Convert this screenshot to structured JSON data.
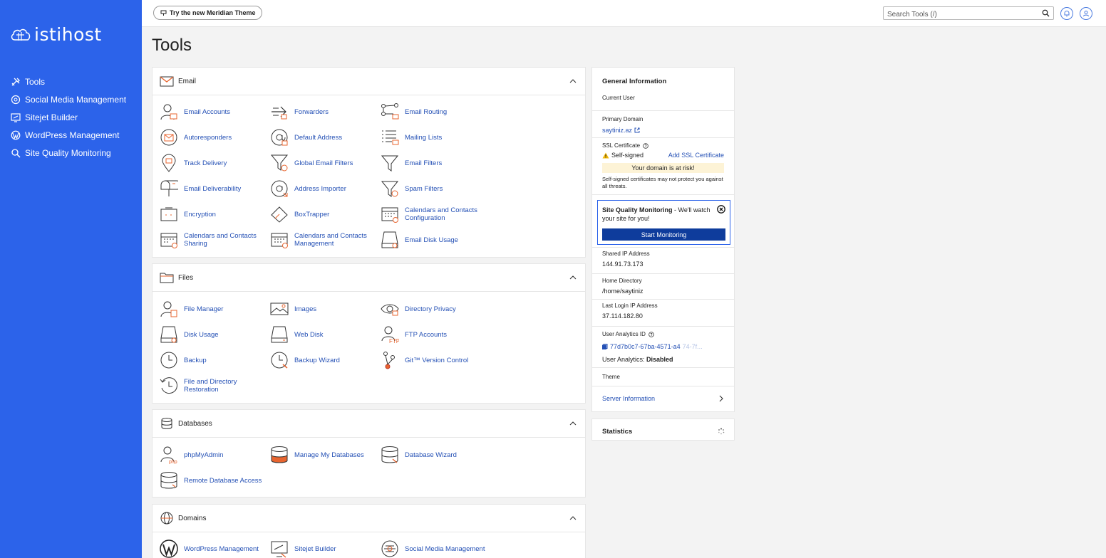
{
  "sidebar": {
    "logo_text": "istihost",
    "items": [
      {
        "label": "Tools",
        "icon": "tools-icon"
      },
      {
        "label": "Social Media Management",
        "icon": "social-media-icon"
      },
      {
        "label": "Sitejet Builder",
        "icon": "sitejet-icon"
      },
      {
        "label": "WordPress Management",
        "icon": "wordpress-icon"
      },
      {
        "label": "Site Quality Monitoring",
        "icon": "magnifier-icon"
      }
    ]
  },
  "topbar": {
    "theme_button": "Try the new Meridian Theme",
    "search_placeholder": "Search Tools (/)"
  },
  "page_title": "Tools",
  "sections": {
    "email": {
      "title": "Email",
      "tools": [
        "Email Accounts",
        "Forwarders",
        "Email Routing",
        "Autoresponders",
        "Default Address",
        "Mailing Lists",
        "Track Delivery",
        "Global Email Filters",
        "Email Filters",
        "Email Deliverability",
        "Address Importer",
        "Spam Filters",
        "Encryption",
        "BoxTrapper",
        "Calendars and Contacts Configuration",
        "Calendars and Contacts Sharing",
        "Calendars and Contacts Management",
        "Email Disk Usage"
      ]
    },
    "files": {
      "title": "Files",
      "tools": [
        "File Manager",
        "Images",
        "Directory Privacy",
        "Disk Usage",
        "Web Disk",
        "FTP Accounts",
        "Backup",
        "Backup Wizard",
        "Git™ Version Control",
        "File and Directory Restoration"
      ]
    },
    "databases": {
      "title": "Databases",
      "tools": [
        "phpMyAdmin",
        "Manage My Databases",
        "Database Wizard",
        "Remote Database Access"
      ]
    },
    "domains": {
      "title": "Domains",
      "tools": [
        "WordPress Management",
        "Sitejet Builder",
        "Social Media Management"
      ]
    }
  },
  "info": {
    "title": "General Information",
    "current_user_label": "Current User",
    "primary_domain_label": "Primary Domain",
    "primary_domain": "saytiniz.az",
    "ssl_label": "SSL Certificate",
    "ssl_status": "Self-signed",
    "ssl_add": "Add SSL Certificate",
    "ssl_warning": "Your domain is at risk!",
    "ssl_note": "Self-signed certificates may not protect you against all threats.",
    "sqm_title": "Site Quality Monitoring",
    "sqm_text": " - We'll watch your site for you!",
    "sqm_button": "Start Monitoring",
    "shared_ip_label": "Shared IP Address",
    "shared_ip": "144.91.73.173",
    "home_dir_label": "Home Directory",
    "home_dir": "/home/saytiniz",
    "last_login_label": "Last Login IP Address",
    "last_login": "37.114.182.80",
    "analytics_label": "User Analytics ID",
    "analytics_id": "77d7b0c7-67ba-4571-a4",
    "analytics_id_faded": "74-7f...",
    "analytics_status_label": "User Analytics: ",
    "analytics_status": "Disabled",
    "theme_label": "Theme",
    "server_info": "Server Information",
    "statistics": "Statistics"
  },
  "colors": {
    "sidebar": "#2c63ea",
    "link": "#2450b5",
    "accent_orange": "#e8652f",
    "button_dark": "#0e3c9c",
    "warning_bg": "#fdf3d6"
  }
}
